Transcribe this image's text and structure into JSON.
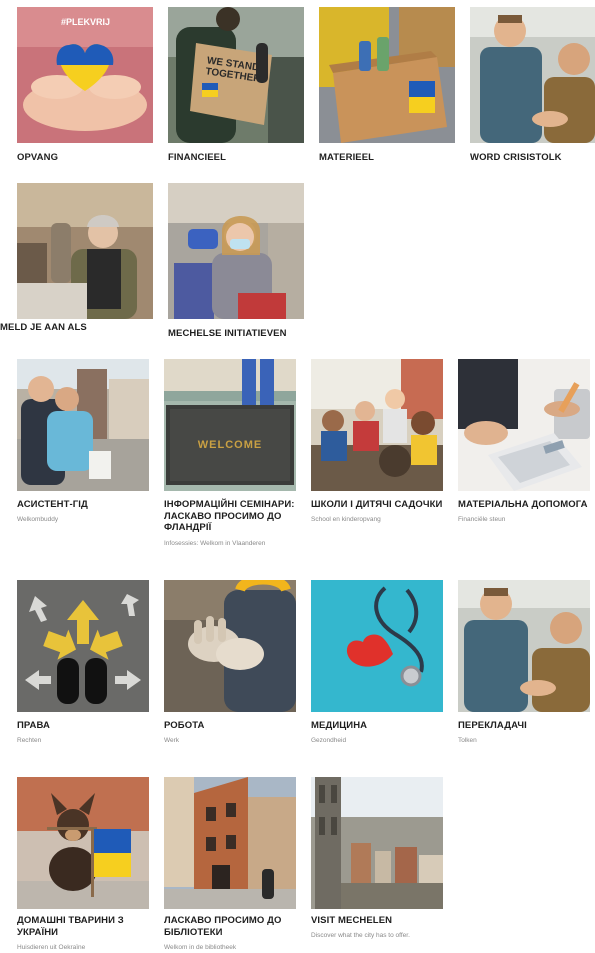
{
  "sections": {
    "dutch_cards": [
      {
        "title": "OPVANG",
        "image_icon": "hands-holding-heart-image",
        "badge_text": "#PLEKVRIJ"
      },
      {
        "title": "FINANCIEEL",
        "image_icon": "protest-sign-image",
        "sign_text": "WE STAND TOGETHER"
      },
      {
        "title": "MATERIEEL",
        "image_icon": "donation-box-image"
      },
      {
        "title": "WORD CRISISTOLK",
        "image_icon": "two-men-talking-image"
      },
      {
        "title": "MELD JE AAN ALS",
        "image_icon": "volunteer-woman-image"
      },
      {
        "title": "MECHELSE INITIATIEVEN",
        "image_icon": "girl-with-mask-image"
      }
    ],
    "ukrainian_cards": [
      {
        "title": "АСИСТЕНТ-ГІД",
        "subtitle": "Welkombuddy",
        "image_icon": "women-on-street-image"
      },
      {
        "title": "ІНФОРМАЦІЙНІ СЕМІНАРИ: ЛАСКАВО ПРОСИМО ДО ФЛАНДРІЇ",
        "subtitle": "Infosessies: Welkom in Vlaanderen",
        "image_icon": "welcome-mat-image",
        "mat_text": "WELCOME"
      },
      {
        "title": "ШКОЛИ І ДИТЯЧІ САДОЧКИ",
        "subtitle": "School en kinderopvang",
        "image_icon": "children-classroom-image"
      },
      {
        "title": "МАТЕРІАЛЬНА ДОПОМОГА",
        "subtitle": "Financiële steun",
        "image_icon": "calculator-image"
      },
      {
        "title": "ПРАВА",
        "subtitle": "Rechten",
        "image_icon": "arrows-on-asphalt-image"
      },
      {
        "title": "РОБОТА",
        "subtitle": "Werk",
        "image_icon": "work-gloves-image"
      },
      {
        "title": "МЕДИЦИНА",
        "subtitle": "Gezondheid",
        "image_icon": "stethoscope-heart-image"
      },
      {
        "title": "ПЕРЕКЛАДАЧІ",
        "subtitle": "Tolken",
        "image_icon": "two-men-talking-image"
      },
      {
        "title": "ДОМАШНІ ТВАРИНИ З УКРАЇНИ",
        "subtitle": "Huisdieren uit Oekraïne",
        "image_icon": "dog-with-flag-image"
      },
      {
        "title": "ЛАСКАВО ПРОСИМО ДО БІБЛІОТЕКИ",
        "subtitle": "Welkom in de bibliotheek",
        "image_icon": "library-building-image"
      },
      {
        "title": "VISIT MECHELEN",
        "subtitle": "Discover what the city has to offer.",
        "image_icon": "city-skyline-image"
      }
    ]
  },
  "colors": {
    "title_text": "#1f1f1f",
    "subtitle_text": "#8a8a8a",
    "ukraine_blue": "#1f5bb8",
    "ukraine_yellow": "#f6cf1f",
    "teal_background": "#33b8cf"
  }
}
